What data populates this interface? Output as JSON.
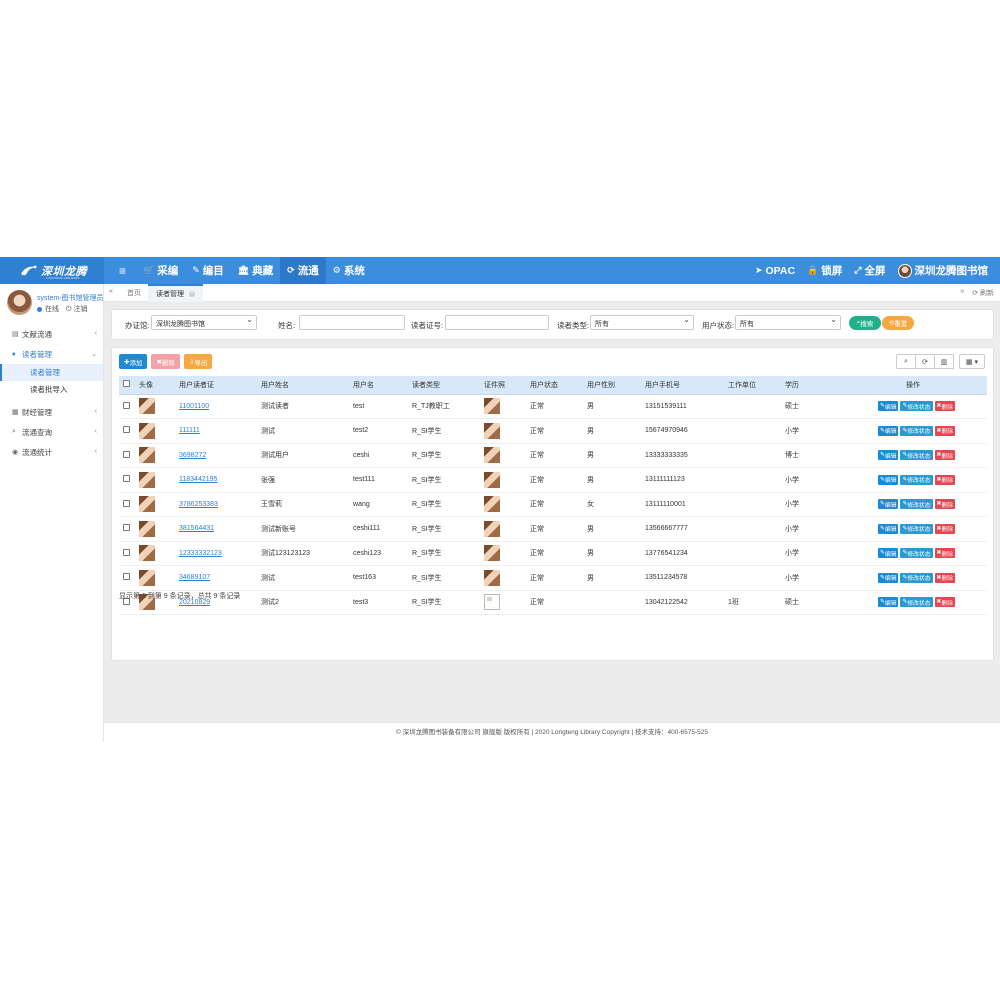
{
  "brand": {
    "name": "深圳龙腾",
    "sub": "LONGTENG LIBRARIES"
  },
  "topnav": {
    "items": [
      {
        "icon": "≡",
        "label": ""
      },
      {
        "icon": "🛒",
        "label": "采编"
      },
      {
        "icon": "✎",
        "label": "编目"
      },
      {
        "icon": "🏛",
        "label": "典藏"
      },
      {
        "icon": "⟳",
        "label": "流通"
      },
      {
        "icon": "⚙",
        "label": "系统"
      }
    ],
    "right": [
      {
        "icon": "➤",
        "label": "OPAC"
      },
      {
        "icon": "🔒",
        "label": "锁屏"
      },
      {
        "icon": "⤢",
        "label": "全屏"
      }
    ],
    "library_name": "深圳龙腾图书馆"
  },
  "sidebar": {
    "username": "system-图书馆管理员",
    "online": "在线",
    "logout": "注销",
    "items": [
      {
        "icon": "▤",
        "label": "文献流通"
      },
      {
        "icon": "♦",
        "label": "读者管理"
      },
      {
        "label": "读者管理"
      },
      {
        "label": "读者批导入"
      },
      {
        "icon": "▦",
        "label": "财经管理"
      },
      {
        "icon": "⌕",
        "label": "流通查询"
      },
      {
        "icon": "◉",
        "label": "流通统计"
      }
    ]
  },
  "tabs": {
    "home": "首页",
    "current": "读者管理",
    "refresh": "刷新"
  },
  "filter": {
    "office_label": "办证馆:",
    "office_value": "深圳龙腾图书馆",
    "name_label": "姓名:",
    "card_label": "读者证号:",
    "type_label": "读者类型:",
    "type_value": "所有",
    "status_label": "用户状态:",
    "status_value": "所有",
    "search_btn": "搜索",
    "reset_btn": "重置"
  },
  "toolbar": {
    "add": "添加",
    "delete": "删除",
    "export": "导出"
  },
  "table": {
    "headers": [
      "",
      "头像",
      "用户读者证",
      "用户姓名",
      "用户名",
      "读者类型",
      "证件照",
      "用户状态",
      "用户性别",
      "用户手机号",
      "工作单位",
      "学历",
      "操作"
    ],
    "rows": [
      {
        "card": "11001100",
        "name": "测试读者",
        "user": "test",
        "type": "R_TJ教职工",
        "status": "正常",
        "gender": "男",
        "phone": "13151539111",
        "work": "",
        "edu": "硕士",
        "photo": true
      },
      {
        "card": "111111",
        "name": "测试",
        "user": "test2",
        "type": "R_SI学生",
        "status": "正常",
        "gender": "男",
        "phone": "15674970946",
        "work": "",
        "edu": "小学",
        "photo": true
      },
      {
        "card": "3698272",
        "name": "测试用户",
        "user": "ceshi",
        "type": "R_SI学生",
        "status": "正常",
        "gender": "男",
        "phone": "13333333335",
        "work": "",
        "edu": "博士",
        "photo": true
      },
      {
        "card": "1183442195",
        "name": "张强",
        "user": "test111",
        "type": "R_SI学生",
        "status": "正常",
        "gender": "男",
        "phone": "13111111123",
        "work": "",
        "edu": "小学",
        "photo": true
      },
      {
        "card": "3786253383",
        "name": "王雪莉",
        "user": "wang",
        "type": "R_SI学生",
        "status": "正常",
        "gender": "女",
        "phone": "13111110001",
        "work": "",
        "edu": "小学",
        "photo": true
      },
      {
        "card": "381564431",
        "name": "测试新账号",
        "user": "ceshi111",
        "type": "R_SI学生",
        "status": "正常",
        "gender": "男",
        "phone": "13566667777",
        "work": "",
        "edu": "小学",
        "photo": true
      },
      {
        "card": "12333332123",
        "name": "测试123123123",
        "user": "ceshi123",
        "type": "R_SI学生",
        "status": "正常",
        "gender": "男",
        "phone": "13776541234",
        "work": "",
        "edu": "小学",
        "photo": true
      },
      {
        "card": "34689107",
        "name": "测试",
        "user": "test163",
        "type": "R_SI学生",
        "status": "正常",
        "gender": "男",
        "phone": "13511234578",
        "work": "",
        "edu": "小学",
        "photo": true
      },
      {
        "card": "20210829",
        "name": "测试2",
        "user": "test3",
        "type": "R_SI学生",
        "status": "正常",
        "gender": "",
        "phone": "13042122542",
        "work": "1班",
        "edu": "硕士",
        "photo": false
      }
    ],
    "ops": {
      "edit": "编辑",
      "modify": "修改状态",
      "delete": "删除"
    }
  },
  "summary": "显示第 1 到第 9 条记录，总共 9 条记录",
  "footer": "© 深圳龙腾图书装备有限公司 旗舰版 版权所有 | 2020 Longteng Library Copyright | 技术支持：400-6575-525",
  "colors": {
    "topbar": "#3c8dde",
    "accent": "#2f7fd3",
    "add": "#1d8ad6",
    "delete": "#f3a1a6",
    "export": "#f4a942",
    "search": "#21b08c",
    "reset": "#f6a740"
  }
}
